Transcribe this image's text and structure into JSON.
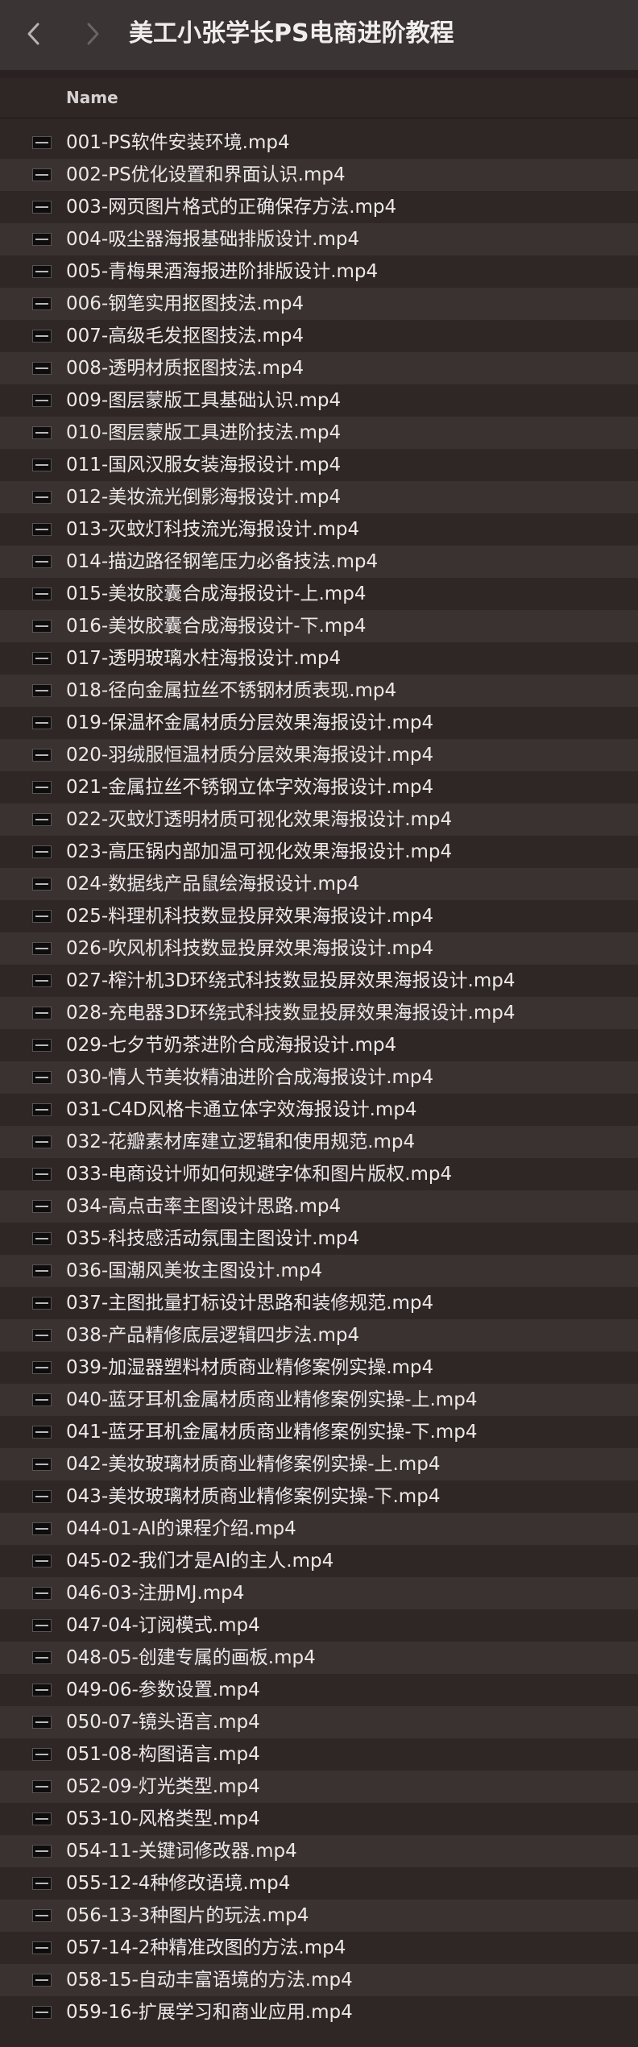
{
  "window": {
    "title": "美工小张学长PS电商进阶教程",
    "back_icon": "chevron-left-icon",
    "forward_icon": "chevron-right-icon"
  },
  "header": {
    "name_col": "Name"
  },
  "colors": {
    "background": "#2f2626",
    "row_alt": "#3a3131",
    "titlebar": "#3b3434",
    "text": "#ece8e8"
  },
  "files": [
    "001-PS软件安装环境.mp4",
    "002-PS优化设置和界面认识.mp4",
    "003-网页图片格式的正确保存方法.mp4",
    "004-吸尘器海报基础排版设计.mp4",
    "005-青梅果酒海报进阶排版设计.mp4",
    "006-钢笔实用抠图技法.mp4",
    "007-高级毛发抠图技法.mp4",
    "008-透明材质抠图技法.mp4",
    "009-图层蒙版工具基础认识.mp4",
    "010-图层蒙版工具进阶技法.mp4",
    "011-国风汉服女装海报设计.mp4",
    "012-美妆流光倒影海报设计.mp4",
    "013-灭蚊灯科技流光海报设计.mp4",
    "014-描边路径钢笔压力必备技法.mp4",
    "015-美妆胶囊合成海报设计-上.mp4",
    "016-美妆胶囊合成海报设计-下.mp4",
    "017-透明玻璃水柱海报设计.mp4",
    "018-径向金属拉丝不锈钢材质表现.mp4",
    "019-保温杯金属材质分层效果海报设计.mp4",
    "020-羽绒服恒温材质分层效果海报设计.mp4",
    "021-金属拉丝不锈钢立体字效海报设计.mp4",
    "022-灭蚊灯透明材质可视化效果海报设计.mp4",
    "023-高压锅内部加温可视化效果海报设计.mp4",
    "024-数据线产品鼠绘海报设计.mp4",
    "025-料理机科技数显投屏效果海报设计.mp4",
    "026-吹风机科技数显投屏效果海报设计.mp4",
    "027-榨汁机3D环绕式科技数显投屏效果海报设计.mp4",
    "028-充电器3D环绕式科技数显投屏效果海报设计.mp4",
    "029-七夕节奶茶进阶合成海报设计.mp4",
    "030-情人节美妆精油进阶合成海报设计.mp4",
    "031-C4D风格卡通立体字效海报设计.mp4",
    "032-花瓣素材库建立逻辑和使用规范.mp4",
    "033-电商设计师如何规避字体和图片版权.mp4",
    "034-高点击率主图设计思路.mp4",
    "035-科技感活动氛围主图设计.mp4",
    "036-国潮风美妆主图设计.mp4",
    "037-主图批量打标设计思路和装修规范.mp4",
    "038-产品精修底层逻辑四步法.mp4",
    "039-加湿器塑料材质商业精修案例实操.mp4",
    "040-蓝牙耳机金属材质商业精修案例实操-上.mp4",
    "041-蓝牙耳机金属材质商业精修案例实操-下.mp4",
    "042-美妆玻璃材质商业精修案例实操-上.mp4",
    "043-美妆玻璃材质商业精修案例实操-下.mp4",
    "044-01-AI的课程介绍.mp4",
    "045-02-我们才是AI的主人.mp4",
    "046-03-注册MJ.mp4",
    "047-04-订阅模式.mp4",
    "048-05-创建专属的画板.mp4",
    "049-06-参数设置.mp4",
    "050-07-镜头语言.mp4",
    "051-08-构图语言.mp4",
    "052-09-灯光类型.mp4",
    "053-10-风格类型.mp4",
    "054-11-关键词修改器.mp4",
    "055-12-4种修改语境.mp4",
    "056-13-3种图片的玩法.mp4",
    "057-14-2种精准改图的方法.mp4",
    "058-15-自动丰富语境的方法.mp4",
    "059-16-扩展学习和商业应用.mp4"
  ]
}
